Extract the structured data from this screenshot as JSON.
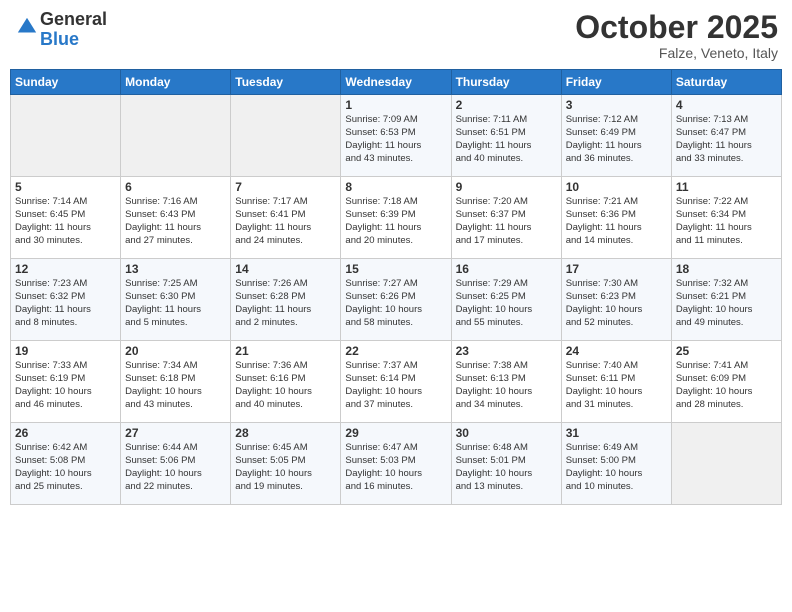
{
  "header": {
    "logo_general": "General",
    "logo_blue": "Blue",
    "month": "October 2025",
    "location": "Falze, Veneto, Italy"
  },
  "columns": [
    "Sunday",
    "Monday",
    "Tuesday",
    "Wednesday",
    "Thursday",
    "Friday",
    "Saturday"
  ],
  "weeks": [
    [
      {
        "num": "",
        "info": ""
      },
      {
        "num": "",
        "info": ""
      },
      {
        "num": "",
        "info": ""
      },
      {
        "num": "1",
        "info": "Sunrise: 7:09 AM\nSunset: 6:53 PM\nDaylight: 11 hours\nand 43 minutes."
      },
      {
        "num": "2",
        "info": "Sunrise: 7:11 AM\nSunset: 6:51 PM\nDaylight: 11 hours\nand 40 minutes."
      },
      {
        "num": "3",
        "info": "Sunrise: 7:12 AM\nSunset: 6:49 PM\nDaylight: 11 hours\nand 36 minutes."
      },
      {
        "num": "4",
        "info": "Sunrise: 7:13 AM\nSunset: 6:47 PM\nDaylight: 11 hours\nand 33 minutes."
      }
    ],
    [
      {
        "num": "5",
        "info": "Sunrise: 7:14 AM\nSunset: 6:45 PM\nDaylight: 11 hours\nand 30 minutes."
      },
      {
        "num": "6",
        "info": "Sunrise: 7:16 AM\nSunset: 6:43 PM\nDaylight: 11 hours\nand 27 minutes."
      },
      {
        "num": "7",
        "info": "Sunrise: 7:17 AM\nSunset: 6:41 PM\nDaylight: 11 hours\nand 24 minutes."
      },
      {
        "num": "8",
        "info": "Sunrise: 7:18 AM\nSunset: 6:39 PM\nDaylight: 11 hours\nand 20 minutes."
      },
      {
        "num": "9",
        "info": "Sunrise: 7:20 AM\nSunset: 6:37 PM\nDaylight: 11 hours\nand 17 minutes."
      },
      {
        "num": "10",
        "info": "Sunrise: 7:21 AM\nSunset: 6:36 PM\nDaylight: 11 hours\nand 14 minutes."
      },
      {
        "num": "11",
        "info": "Sunrise: 7:22 AM\nSunset: 6:34 PM\nDaylight: 11 hours\nand 11 minutes."
      }
    ],
    [
      {
        "num": "12",
        "info": "Sunrise: 7:23 AM\nSunset: 6:32 PM\nDaylight: 11 hours\nand 8 minutes."
      },
      {
        "num": "13",
        "info": "Sunrise: 7:25 AM\nSunset: 6:30 PM\nDaylight: 11 hours\nand 5 minutes."
      },
      {
        "num": "14",
        "info": "Sunrise: 7:26 AM\nSunset: 6:28 PM\nDaylight: 11 hours\nand 2 minutes."
      },
      {
        "num": "15",
        "info": "Sunrise: 7:27 AM\nSunset: 6:26 PM\nDaylight: 10 hours\nand 58 minutes."
      },
      {
        "num": "16",
        "info": "Sunrise: 7:29 AM\nSunset: 6:25 PM\nDaylight: 10 hours\nand 55 minutes."
      },
      {
        "num": "17",
        "info": "Sunrise: 7:30 AM\nSunset: 6:23 PM\nDaylight: 10 hours\nand 52 minutes."
      },
      {
        "num": "18",
        "info": "Sunrise: 7:32 AM\nSunset: 6:21 PM\nDaylight: 10 hours\nand 49 minutes."
      }
    ],
    [
      {
        "num": "19",
        "info": "Sunrise: 7:33 AM\nSunset: 6:19 PM\nDaylight: 10 hours\nand 46 minutes."
      },
      {
        "num": "20",
        "info": "Sunrise: 7:34 AM\nSunset: 6:18 PM\nDaylight: 10 hours\nand 43 minutes."
      },
      {
        "num": "21",
        "info": "Sunrise: 7:36 AM\nSunset: 6:16 PM\nDaylight: 10 hours\nand 40 minutes."
      },
      {
        "num": "22",
        "info": "Sunrise: 7:37 AM\nSunset: 6:14 PM\nDaylight: 10 hours\nand 37 minutes."
      },
      {
        "num": "23",
        "info": "Sunrise: 7:38 AM\nSunset: 6:13 PM\nDaylight: 10 hours\nand 34 minutes."
      },
      {
        "num": "24",
        "info": "Sunrise: 7:40 AM\nSunset: 6:11 PM\nDaylight: 10 hours\nand 31 minutes."
      },
      {
        "num": "25",
        "info": "Sunrise: 7:41 AM\nSunset: 6:09 PM\nDaylight: 10 hours\nand 28 minutes."
      }
    ],
    [
      {
        "num": "26",
        "info": "Sunrise: 6:42 AM\nSunset: 5:08 PM\nDaylight: 10 hours\nand 25 minutes."
      },
      {
        "num": "27",
        "info": "Sunrise: 6:44 AM\nSunset: 5:06 PM\nDaylight: 10 hours\nand 22 minutes."
      },
      {
        "num": "28",
        "info": "Sunrise: 6:45 AM\nSunset: 5:05 PM\nDaylight: 10 hours\nand 19 minutes."
      },
      {
        "num": "29",
        "info": "Sunrise: 6:47 AM\nSunset: 5:03 PM\nDaylight: 10 hours\nand 16 minutes."
      },
      {
        "num": "30",
        "info": "Sunrise: 6:48 AM\nSunset: 5:01 PM\nDaylight: 10 hours\nand 13 minutes."
      },
      {
        "num": "31",
        "info": "Sunrise: 6:49 AM\nSunset: 5:00 PM\nDaylight: 10 hours\nand 10 minutes."
      },
      {
        "num": "",
        "info": ""
      }
    ]
  ]
}
